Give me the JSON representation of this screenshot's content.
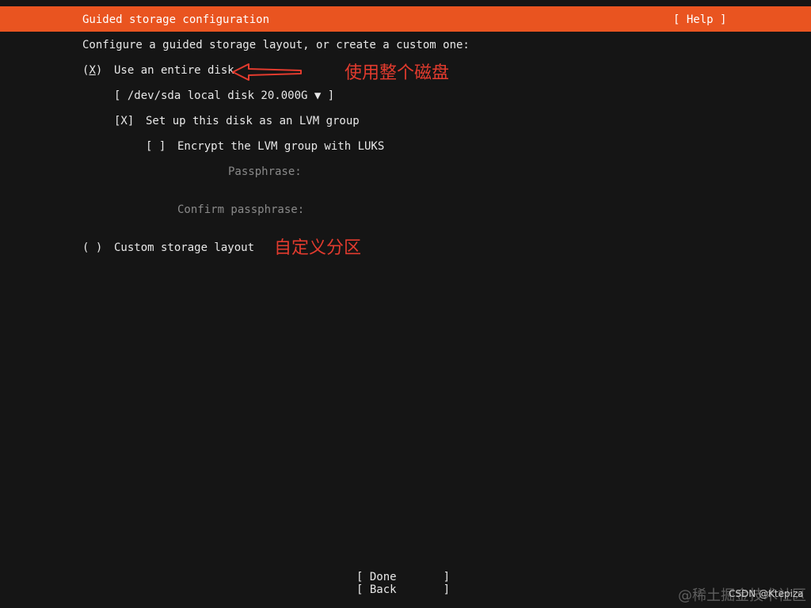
{
  "header": {
    "title": "Guided storage configuration",
    "help_label": "[ Help ]",
    "accent_color": "#e95420"
  },
  "intro_text": "Configure a guided storage layout, or create a custom one:",
  "entire_disk": {
    "radio_open": "(",
    "radio_mark": "X",
    "radio_close": ")",
    "label": "Use an entire disk",
    "selected": true
  },
  "disk_select": {
    "open": "[ ",
    "value": "/dev/sda local disk 20.000G",
    "arrow": "▼",
    "close": " ]"
  },
  "lvm": {
    "checkbox": "[X]",
    "label": "Set up this disk as an LVM group",
    "checked": true
  },
  "encrypt": {
    "checkbox": "[ ]",
    "label": "Encrypt the LVM group with LUKS",
    "checked": false
  },
  "passphrase": {
    "label": "Passphrase:",
    "value": ""
  },
  "confirm_passphrase": {
    "label": "Confirm passphrase:",
    "value": ""
  },
  "custom_layout": {
    "radio": "( )",
    "label": "Custom storage layout",
    "selected": false
  },
  "buttons": {
    "done": "[ Done       ]",
    "back": "[ Back       ]"
  },
  "annotations": {
    "use_entire_disk": "使用整个磁盘",
    "custom_partition": "自定义分区",
    "color": "#e23b2e"
  },
  "watermarks": {
    "juejin": "@稀土掘金技术社区",
    "csdn": "CSDN @Ktepiza"
  }
}
